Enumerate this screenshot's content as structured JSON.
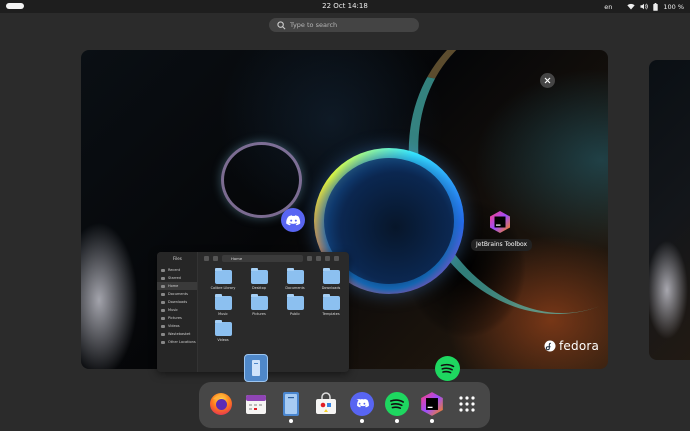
{
  "topbar": {
    "clock": "22 Oct  14:18",
    "language": "en",
    "battery": "100 %",
    "icons": [
      "wifi-icon",
      "volume-icon",
      "battery-icon"
    ]
  },
  "search": {
    "placeholder": "Type to search"
  },
  "workspace": {
    "brand": "fedora",
    "windows": [
      {
        "name": "Discord",
        "icon": "discord-icon"
      },
      {
        "name": "JetBrains Toolbox",
        "icon": "jetbrains-toolbox-icon"
      },
      {
        "name": "Files",
        "icon": "files-icon"
      },
      {
        "name": "Spotify",
        "icon": "spotify-icon"
      }
    ],
    "jetbrains_label": "JetBrains Toolbox"
  },
  "files_window": {
    "title": "Files",
    "path": "Home",
    "sidebar": [
      "Recent",
      "Starred",
      "Home",
      "Documents",
      "Downloads",
      "Music",
      "Pictures",
      "Videos",
      "Wastebasket",
      "Other Locations"
    ],
    "folders": [
      "Calibre Library",
      "Desktop",
      "Documents",
      "Downloads",
      "Music",
      "Pictures",
      "Public",
      "Templates",
      "Videos"
    ]
  },
  "dock": {
    "items": [
      {
        "name": "Firefox",
        "icon": "firefox-icon",
        "running": false
      },
      {
        "name": "Calendar",
        "icon": "calendar-icon",
        "running": false
      },
      {
        "name": "Files",
        "icon": "files-icon",
        "running": true
      },
      {
        "name": "Software",
        "icon": "software-icon",
        "running": false
      },
      {
        "name": "Discord",
        "icon": "discord-icon",
        "running": true
      },
      {
        "name": "Spotify",
        "icon": "spotify-icon",
        "running": true
      },
      {
        "name": "JetBrains Toolbox",
        "icon": "jetbrains-toolbox-icon",
        "running": true
      },
      {
        "name": "Show Apps",
        "icon": "app-grid-icon",
        "running": false
      }
    ]
  },
  "colors": {
    "accent": "#5865f2",
    "spotify": "#1ed760",
    "folder": "#8cc0f0"
  }
}
